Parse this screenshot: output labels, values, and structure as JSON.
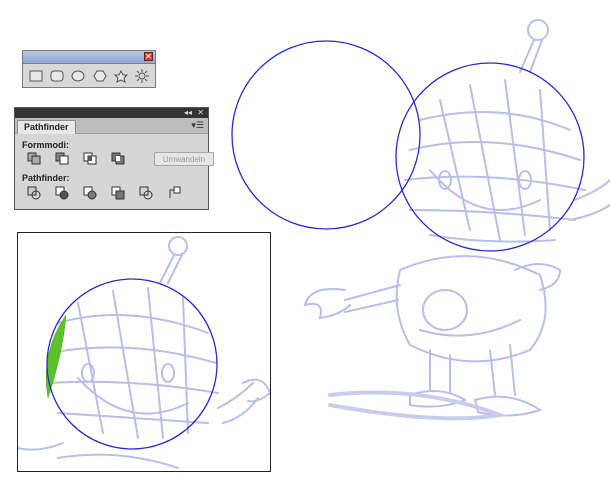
{
  "shape_toolbar": {
    "tools": [
      {
        "icon": "rectangle-icon"
      },
      {
        "icon": "rounded-rectangle-icon"
      },
      {
        "icon": "ellipse-icon"
      },
      {
        "icon": "polygon-icon"
      },
      {
        "icon": "star-icon"
      },
      {
        "icon": "flare-icon"
      }
    ],
    "close_icon": "close-icon"
  },
  "pathfinder": {
    "tab_label": "Pathfinder",
    "formmodi_label": "Formmodi:",
    "pathfinder_label": "Pathfinder:",
    "expand_button": "Umwandeln",
    "formmodi_icons": [
      "unite-icon",
      "minus-front-icon",
      "intersect-icon",
      "exclude-icon"
    ],
    "pathfinder_icons": [
      "divide-icon",
      "trim-icon",
      "merge-icon",
      "crop-icon",
      "outline-icon",
      "minus-back-icon"
    ]
  },
  "colors": {
    "sketch": "#b9bfe6",
    "circle_stroke": "#2a2ad0",
    "highlight": "#5cc22a"
  }
}
